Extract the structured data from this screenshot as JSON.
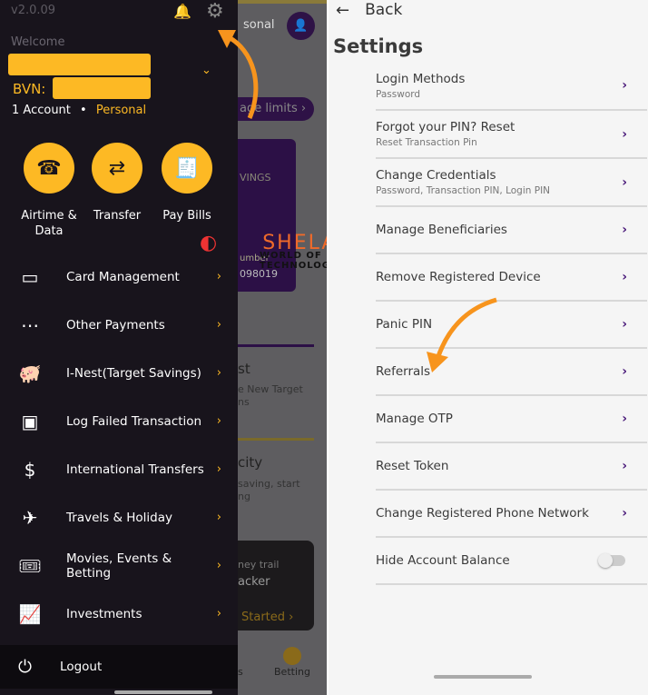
{
  "drawer": {
    "version": "v2.0.09",
    "welcome": "Welcome",
    "bvn_label": "BVN:",
    "accounts": "1 Account",
    "account_type": "Personal",
    "quick_actions": [
      {
        "label": "Airtime & Data",
        "icon": "telephone-icon"
      },
      {
        "label": "Transfer",
        "icon": "transfer-arrows-icon"
      },
      {
        "label": "Pay Bills",
        "icon": "receipt-icon"
      }
    ],
    "menu": [
      {
        "label": "Card Management",
        "icon": "card-icon"
      },
      {
        "label": "Other Payments",
        "icon": "more-dots-icon"
      },
      {
        "label": "I-Nest(Target Savings)",
        "icon": "piggy-bank-icon"
      },
      {
        "label": "Log Failed Transaction",
        "icon": "log-icon"
      },
      {
        "label": "International Transfers",
        "icon": "dollar-exchange-icon"
      },
      {
        "label": "Travels & Holiday",
        "icon": "airplane-icon"
      },
      {
        "label": "Movies, Events & Betting",
        "icon": "ticket-icon"
      },
      {
        "label": "Investments",
        "icon": "chart-up-icon"
      }
    ],
    "logout": "Logout"
  },
  "background": {
    "personal": "sonal",
    "limits": "age limits",
    "savings": "VINGS",
    "number_label": "umber",
    "number": "098019",
    "card1_title": "st",
    "card1_text1": "e New Target",
    "card1_text2": "ns",
    "card2_title": "city",
    "card2_text1": "saving, start",
    "card2_text2": "ng",
    "tracker1": "ney trail",
    "tracker2": "acker",
    "started": "Started",
    "nav1": "s",
    "nav_betting": "Betting"
  },
  "watermark": {
    "name": "SHELAF",
    "tagline": "WORLD OF TECHNOLOGY"
  },
  "settings": {
    "back": "Back",
    "title": "Settings",
    "items": [
      {
        "title": "Login Methods",
        "sub": "Password"
      },
      {
        "title": "Forgot your PIN? Reset",
        "sub": "Reset Transaction Pin"
      },
      {
        "title": "Change Credentials",
        "sub": "Password, Transaction PIN, Login PIN"
      },
      {
        "title": "Manage Beneficiaries"
      },
      {
        "title": "Remove Registered Device"
      },
      {
        "title": "Panic PIN"
      },
      {
        "title": "Referrals"
      },
      {
        "title": "Manage OTP"
      },
      {
        "title": "Reset Token"
      },
      {
        "title": "Change Registered Phone Network"
      },
      {
        "title": "Hide Account Balance",
        "toggle": false
      }
    ]
  },
  "colors": {
    "accent": "#fdb924",
    "brand": "#4a1a7a",
    "drawer_bg": "#18141c"
  }
}
